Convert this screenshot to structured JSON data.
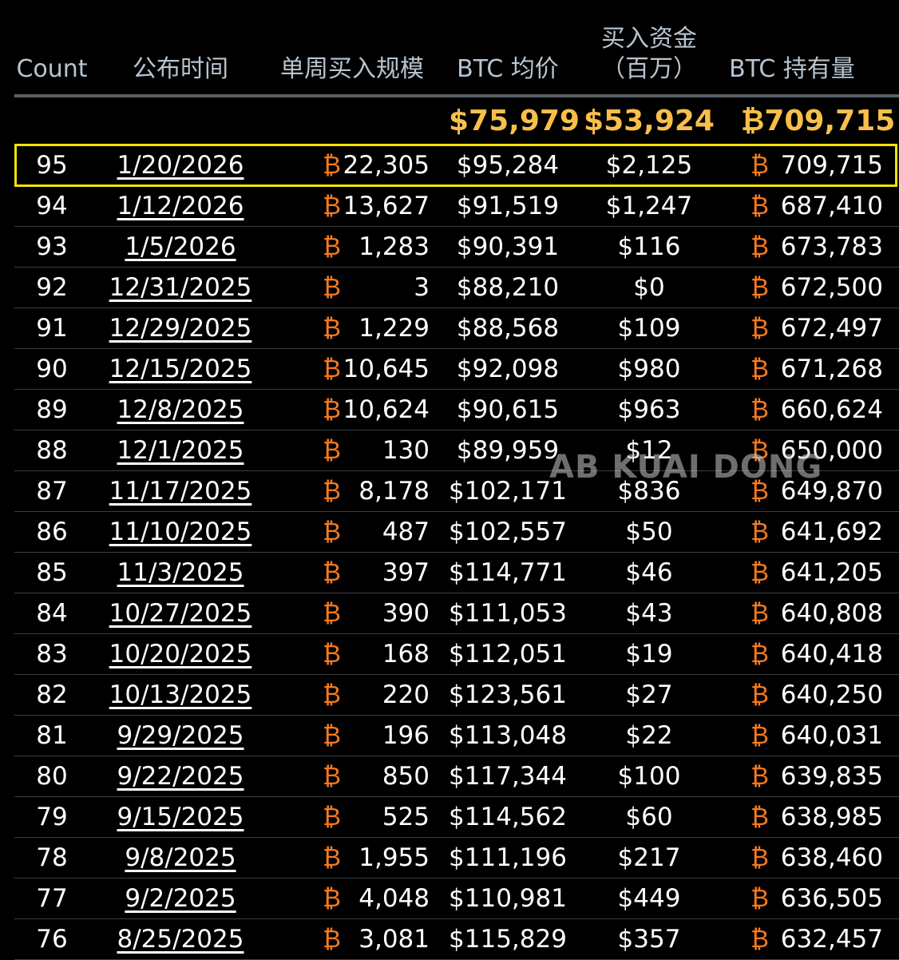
{
  "header": {
    "count": "Count",
    "date": "公布时间",
    "weekly": "单周买入规模",
    "avg": "BTC 均价",
    "funds_line1": "买入资金",
    "funds_line2": "（百万）",
    "holdings": "BTC 持有量"
  },
  "totals": {
    "avg": "$75,979",
    "funds": "$53,924",
    "holdings": "₿709,715"
  },
  "btc_symbol": "₿",
  "watermark": "AB KUAI DONG",
  "colors": {
    "background": "#000000",
    "header_text": "#b8c4cf",
    "totals": "#f7bf4a",
    "btc_symbol": "#f47a1f",
    "highlight_border": "#f5e300"
  },
  "rows": [
    {
      "count": "95",
      "date": "1/20/2026",
      "weekly": "22,305",
      "avg": "$95,284",
      "funds": "$2,125",
      "holdings": "709,715"
    },
    {
      "count": "94",
      "date": "1/12/2026",
      "weekly": "13,627",
      "avg": "$91,519",
      "funds": "$1,247",
      "holdings": "687,410"
    },
    {
      "count": "93",
      "date": "1/5/2026",
      "weekly": "1,283",
      "avg": "$90,391",
      "funds": "$116",
      "holdings": "673,783"
    },
    {
      "count": "92",
      "date": "12/31/2025",
      "weekly": "3",
      "avg": "$88,210",
      "funds": "$0",
      "holdings": "672,500"
    },
    {
      "count": "91",
      "date": "12/29/2025",
      "weekly": "1,229",
      "avg": "$88,568",
      "funds": "$109",
      "holdings": "672,497"
    },
    {
      "count": "90",
      "date": "12/15/2025",
      "weekly": "10,645",
      "avg": "$92,098",
      "funds": "$980",
      "holdings": "671,268"
    },
    {
      "count": "89",
      "date": "12/8/2025",
      "weekly": "10,624",
      "avg": "$90,615",
      "funds": "$963",
      "holdings": "660,624"
    },
    {
      "count": "88",
      "date": "12/1/2025",
      "weekly": "130",
      "avg": "$89,959",
      "funds": "$12",
      "holdings": "650,000"
    },
    {
      "count": "87",
      "date": "11/17/2025",
      "weekly": "8,178",
      "avg": "$102,171",
      "funds": "$836",
      "holdings": "649,870"
    },
    {
      "count": "86",
      "date": "11/10/2025",
      "weekly": "487",
      "avg": "$102,557",
      "funds": "$50",
      "holdings": "641,692"
    },
    {
      "count": "85",
      "date": "11/3/2025",
      "weekly": "397",
      "avg": "$114,771",
      "funds": "$46",
      "holdings": "641,205"
    },
    {
      "count": "84",
      "date": "10/27/2025",
      "weekly": "390",
      "avg": "$111,053",
      "funds": "$43",
      "holdings": "640,808"
    },
    {
      "count": "83",
      "date": "10/20/2025",
      "weekly": "168",
      "avg": "$112,051",
      "funds": "$19",
      "holdings": "640,418"
    },
    {
      "count": "82",
      "date": "10/13/2025",
      "weekly": "220",
      "avg": "$123,561",
      "funds": "$27",
      "holdings": "640,250"
    },
    {
      "count": "81",
      "date": "9/29/2025",
      "weekly": "196",
      "avg": "$113,048",
      "funds": "$22",
      "holdings": "640,031"
    },
    {
      "count": "80",
      "date": "9/22/2025",
      "weekly": "850",
      "avg": "$117,344",
      "funds": "$100",
      "holdings": "639,835"
    },
    {
      "count": "79",
      "date": "9/15/2025",
      "weekly": "525",
      "avg": "$114,562",
      "funds": "$60",
      "holdings": "638,985"
    },
    {
      "count": "78",
      "date": "9/8/2025",
      "weekly": "1,955",
      "avg": "$111,196",
      "funds": "$217",
      "holdings": "638,460"
    },
    {
      "count": "77",
      "date": "9/2/2025",
      "weekly": "4,048",
      "avg": "$110,981",
      "funds": "$449",
      "holdings": "636,505"
    },
    {
      "count": "76",
      "date": "8/25/2025",
      "weekly": "3,081",
      "avg": "$115,829",
      "funds": "$357",
      "holdings": "632,457"
    }
  ]
}
